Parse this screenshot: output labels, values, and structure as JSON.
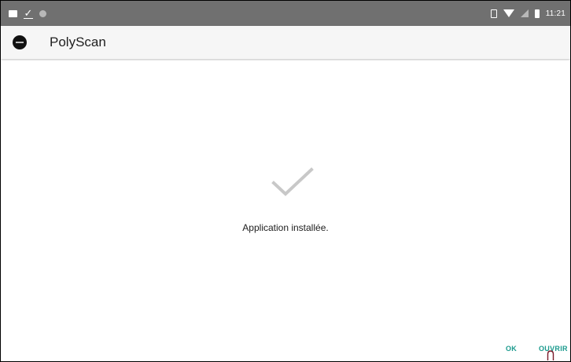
{
  "status_bar": {
    "time": "11:21",
    "left_icons": [
      "image-icon",
      "download-done-icon",
      "circle-notification-icon"
    ],
    "right_icons": [
      "vibrate-icon",
      "wifi-icon",
      "no-signal-icon",
      "battery-icon"
    ]
  },
  "app_bar": {
    "title": "PolyScan",
    "logo_icon": "polyscan-logo"
  },
  "main": {
    "status_icon": "check-icon",
    "message": "Application installée."
  },
  "actions": {
    "ok_label": "OK",
    "open_label": "OUVRIR"
  },
  "colors": {
    "status_bar": "#707070",
    "app_bar": "#f6f6f6",
    "accent": "#1a9a8d",
    "check": "#c8c8c8"
  }
}
